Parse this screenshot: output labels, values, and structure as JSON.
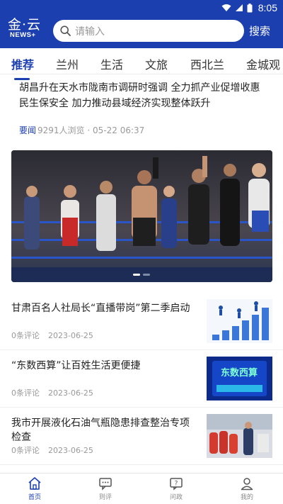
{
  "statusbar": {
    "time": "8:05"
  },
  "header": {
    "logo_main": "金·云",
    "logo_sub": "NEWS+",
    "search_placeholder": "请输入",
    "search_button": "搜索"
  },
  "tabs": [
    {
      "label": "推荐",
      "active": true
    },
    {
      "label": "兰州"
    },
    {
      "label": "生活"
    },
    {
      "label": "文旅"
    },
    {
      "label": "西北兰"
    },
    {
      "label": "金城观"
    }
  ],
  "feature_article": {
    "title": "胡昌升在天水市陇南市调研时强调 全力抓产业促增收惠民生保安全 加力推动县域经济实现整体跃升",
    "tag": "要闻",
    "views": "9291人浏览",
    "separator": "·",
    "time": "05-22 06:37"
  },
  "news": [
    {
      "title": "甘肃百名人社局长“直播带岗”第二季启动",
      "comments": "0条评论",
      "date": "2023-06-25",
      "thumb": "chart-figures"
    },
    {
      "title": "“东数西算”让百姓生活更便捷",
      "comments": "0条评论",
      "date": "2023-06-25",
      "thumb": "data-computing",
      "thumb_text": "东数西算"
    },
    {
      "title": "我市开展液化石油气瓶隐患排查整治专项检查",
      "comments": "0条评论",
      "date": "2023-06-25",
      "thumb": "gas-cylinders"
    }
  ],
  "bottom_nav": [
    {
      "label": "首页",
      "icon": "home-icon",
      "active": true
    },
    {
      "label": "则评",
      "icon": "comment-icon"
    },
    {
      "label": "问政",
      "icon": "question-icon"
    },
    {
      "label": "我的",
      "icon": "user-icon"
    }
  ],
  "colors": {
    "brand": "#1c3fb0",
    "muted": "#999999"
  }
}
